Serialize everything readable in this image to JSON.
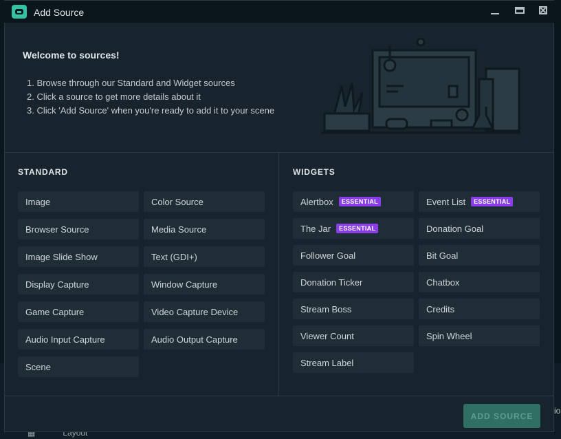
{
  "window": {
    "title": "Add Source"
  },
  "welcome": {
    "title": "Welcome to sources!",
    "steps": [
      "1. Browse through our Standard and Widget sources",
      "2. Click a source to get more details about it",
      "3. Click 'Add Source' when you're ready to add it to your scene"
    ]
  },
  "standard": {
    "title": "STANDARD",
    "items": [
      "Image",
      "Color Source",
      "Browser Source",
      "Media Source",
      "Image Slide Show",
      "Text (GDI+)",
      "Display Capture",
      "Window Capture",
      "Game Capture",
      "Video Capture Device",
      "Audio Input Capture",
      "Audio Output Capture",
      "Scene"
    ]
  },
  "widgets": {
    "title": "WIDGETS",
    "items": [
      {
        "label": "Alertbox",
        "badge": "ESSENTIAL"
      },
      {
        "label": "Event List",
        "badge": "ESSENTIAL"
      },
      {
        "label": "The Jar",
        "badge": "ESSENTIAL"
      },
      {
        "label": "Donation Goal",
        "badge": ""
      },
      {
        "label": "Follower Goal",
        "badge": ""
      },
      {
        "label": "Bit Goal",
        "badge": ""
      },
      {
        "label": "Donation Ticker",
        "badge": ""
      },
      {
        "label": "Chatbox",
        "badge": ""
      },
      {
        "label": "Stream Boss",
        "badge": ""
      },
      {
        "label": "Credits",
        "badge": ""
      },
      {
        "label": "Viewer Count",
        "badge": ""
      },
      {
        "label": "Spin Wheel",
        "badge": ""
      },
      {
        "label": "Stream Label",
        "badge": ""
      }
    ]
  },
  "footer": {
    "add_label": "ADD SOURCE"
  },
  "background": {
    "right_text": "io",
    "bottom_icon": "grid-icon",
    "layout_label": "Layout"
  },
  "colors": {
    "accent": "#31c3a2",
    "badge": "#8b3ee8",
    "panel": "#17242d",
    "tile": "#1f2d36"
  }
}
